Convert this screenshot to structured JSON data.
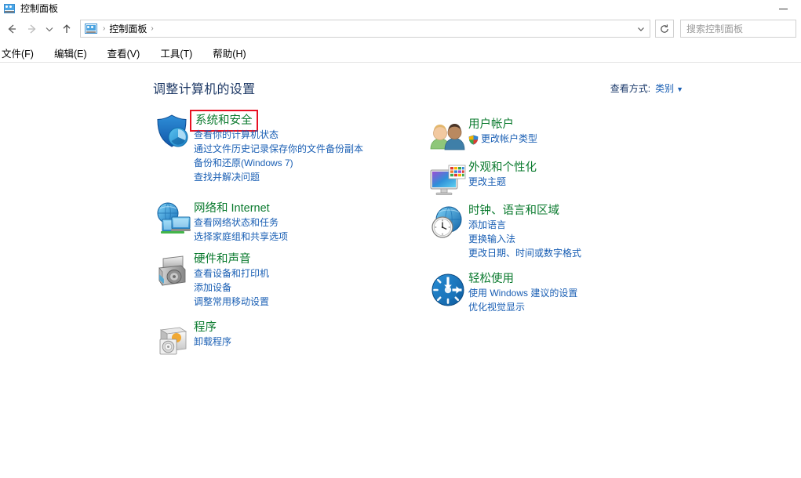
{
  "window": {
    "title": "控制面板",
    "icon": "control-panel-icon",
    "minimize_label": "—"
  },
  "addressbar": {
    "back_icon": "arrow-left-icon",
    "forward_icon": "arrow-right-icon",
    "recent_icon": "chevron-down-icon",
    "up_icon": "arrow-up-icon",
    "path_icon": "control-panel-icon",
    "breadcrumbs": [
      "控制面板"
    ],
    "separator": "›",
    "dropdown_icon": "chevron-down-icon",
    "refresh_icon": "refresh-icon"
  },
  "search": {
    "placeholder": "搜索控制面板",
    "value": ""
  },
  "menubar": {
    "items": [
      {
        "label": "文件(F)"
      },
      {
        "label": "编辑(E)"
      },
      {
        "label": "查看(V)"
      },
      {
        "label": "工具(T)"
      },
      {
        "label": "帮助(H)"
      }
    ]
  },
  "main": {
    "heading": "调整计算机的设置",
    "viewby": {
      "label": "查看方式:",
      "value": "类别",
      "caret": "▼"
    }
  },
  "colors": {
    "heading": "#1f3a66",
    "category_title": "#0a7a2e",
    "link": "#1a5fb4",
    "highlight_box": "#e81123"
  },
  "categories": {
    "left": [
      {
        "title": "系统和安全",
        "icon": "shield-icon",
        "highlighted": true,
        "links": [
          {
            "text": "查看你的计算机状态",
            "shield": false
          },
          {
            "text": "通过文件历史记录保存你的文件备份副本",
            "shield": false
          },
          {
            "text": "备份和还原(Windows 7)",
            "shield": false
          },
          {
            "text": "查找并解决问题",
            "shield": false
          }
        ]
      },
      {
        "title": "网络和 Internet",
        "icon": "network-globe-icon",
        "highlighted": false,
        "links": [
          {
            "text": "查看网络状态和任务",
            "shield": false
          },
          {
            "text": "选择家庭组和共享选项",
            "shield": false
          }
        ]
      },
      {
        "title": "硬件和声音",
        "icon": "printer-icon",
        "highlighted": false,
        "links": [
          {
            "text": "查看设备和打印机",
            "shield": false
          },
          {
            "text": "添加设备",
            "shield": false
          },
          {
            "text": "调整常用移动设置",
            "shield": false
          }
        ]
      },
      {
        "title": "程序",
        "icon": "programs-disc-icon",
        "highlighted": false,
        "links": [
          {
            "text": "卸载程序",
            "shield": false
          }
        ]
      }
    ],
    "right": [
      {
        "title": "用户帐户",
        "icon": "users-icon",
        "highlighted": false,
        "links": [
          {
            "text": "更改帐户类型",
            "shield": true
          }
        ]
      },
      {
        "title": "外观和个性化",
        "icon": "monitor-palette-icon",
        "highlighted": false,
        "links": [
          {
            "text": "更改主题",
            "shield": false
          }
        ]
      },
      {
        "title": "时钟、语言和区域",
        "icon": "clock-globe-icon",
        "highlighted": false,
        "links": [
          {
            "text": "添加语言",
            "shield": false
          },
          {
            "text": "更换输入法",
            "shield": false
          },
          {
            "text": "更改日期、时间或数字格式",
            "shield": false
          }
        ]
      },
      {
        "title": "轻松使用",
        "icon": "ease-of-access-icon",
        "highlighted": false,
        "links": [
          {
            "text": "使用 Windows 建议的设置",
            "shield": false
          },
          {
            "text": "优化视觉显示",
            "shield": false
          }
        ]
      }
    ]
  }
}
